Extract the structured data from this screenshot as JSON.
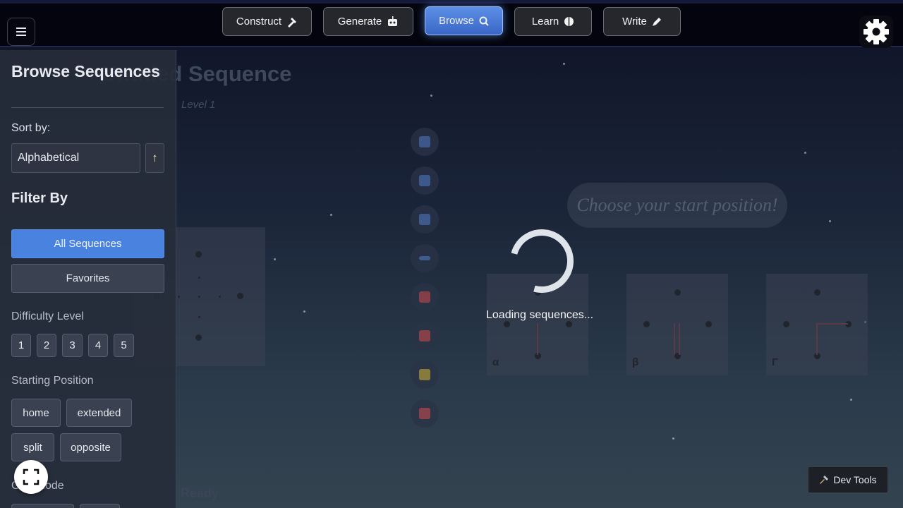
{
  "nav": {
    "menu_icon": "hamburger-icon",
    "tabs": [
      {
        "label": "Construct",
        "icon": "hammer-icon"
      },
      {
        "label": "Generate",
        "icon": "robot-icon"
      },
      {
        "label": "Browse",
        "icon": "search-icon",
        "active": true
      },
      {
        "label": "Learn",
        "icon": "brain-icon"
      },
      {
        "label": "Write",
        "icon": "pen-icon"
      }
    ],
    "settings_icon": "gear-icon"
  },
  "sidebar": {
    "title": "Browse Sequences",
    "sort_label": "Sort by:",
    "sort_value": "Alphabetical",
    "sort_direction": "↑",
    "filter_heading": "Filter By",
    "filters": [
      "All Sequences",
      "Favorites"
    ],
    "difficulty_label": "Difficulty Level",
    "difficulty_levels": [
      "1",
      "2",
      "3",
      "4",
      "5"
    ],
    "starting_position_label": "Starting Position",
    "starting_positions": [
      "home",
      "extended",
      "split",
      "opposite"
    ],
    "grid_mode_label": "Grid Mode"
  },
  "workspace": {
    "title": "Untitled Sequence",
    "level": "Level 1",
    "start_prompt": "Choose your start position!",
    "status": "Ready",
    "start_positions": [
      "α",
      "β",
      "Γ"
    ]
  },
  "loading": {
    "text": "Loading sequences..."
  },
  "footer": {
    "dev_tools_label": "Dev Tools",
    "dev_tools_icon": "tools-icon",
    "fullscreen_icon": "fullscreen-icon"
  },
  "colors": {
    "accent": "#4a82e0",
    "nav_bg": "#03040d"
  }
}
